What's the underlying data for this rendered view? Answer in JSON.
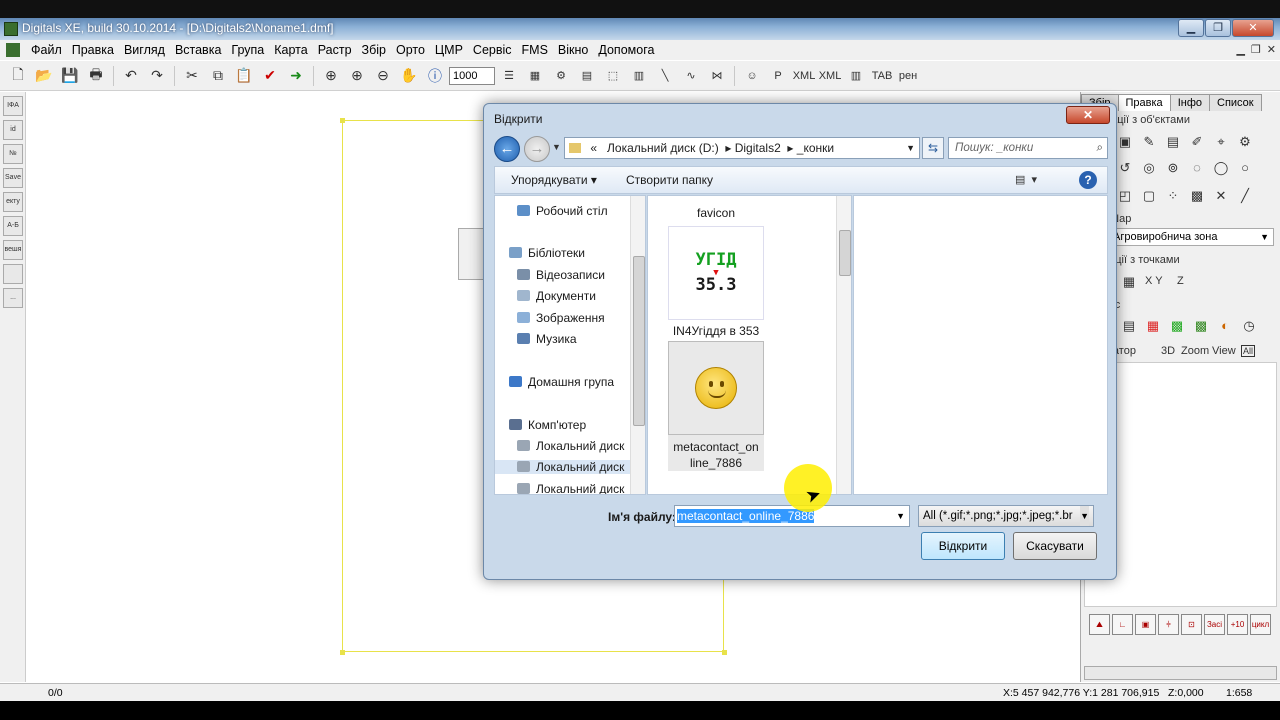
{
  "window": {
    "title": "Digitals XE, build 30.10.2014 - [D:\\Digitals2\\Noname1.dmf]"
  },
  "menu": [
    "Файл",
    "Правка",
    "Вигляд",
    "Вставка",
    "Група",
    "Карта",
    "Растр",
    "Збір",
    "Орто",
    "ЦМР",
    "Сервіс",
    "FMS",
    "Вікно",
    "Допомога"
  ],
  "toolbar": {
    "zoom_value": "1000",
    "icons": [
      "new-icon",
      "open-icon",
      "save-icon",
      "print-icon",
      "undo-icon",
      "redo-icon",
      "cut-icon",
      "copy-icon",
      "paste-icon",
      "check-icon",
      "arrow-icon",
      "zoom-extent-icon",
      "zoom-in-icon",
      "zoom-out-icon",
      "pan-icon",
      "info-icon"
    ]
  },
  "left_toolbar": [
    "ІФА 331",
    "id",
    "№",
    "Save",
    "екту",
    "А-Б",
    "вешя з",
    "",
    "..."
  ],
  "right_panel": {
    "tabs": [
      "Збір",
      "Правка",
      "Інфо",
      "Список"
    ],
    "active_tab": "Правка",
    "section_objects": "рації з об'єктами",
    "section_layer": "Шар",
    "layer_value": "Агровиробнича зона",
    "section_points": "рації з точками",
    "points_labels": [
      "X Y",
      "Z"
    ],
    "section_vis": "Віс",
    "navigator_label": "игатор",
    "navigator_items": [
      "3D",
      "Zoom",
      "View",
      "All"
    ],
    "bottom_buttons": [
      "Засі",
      "+10",
      "цикл"
    ]
  },
  "status": {
    "left": "0/0",
    "coords": "X:5 457 942,776 Y:1 281 706,915",
    "z": "Z:0,000",
    "scale": "1:658"
  },
  "dialog": {
    "title": "Відкрити",
    "breadcrumb": [
      "«",
      "Локальний диск (D:)",
      "Digitals2",
      "_конки"
    ],
    "search_placeholder": "Пошук: _конки",
    "organize": "Упорядкувати",
    "new_folder": "Створити папку",
    "tree": [
      {
        "label": "Робочий стіл",
        "indent": 1
      },
      {
        "label": "Бібліотеки",
        "indent": 0
      },
      {
        "label": "Відеозаписи",
        "indent": 1
      },
      {
        "label": "Документи",
        "indent": 1
      },
      {
        "label": "Зображення",
        "indent": 1
      },
      {
        "label": "Музика",
        "indent": 1
      },
      {
        "label": "Домашня група",
        "indent": 0
      },
      {
        "label": "Комп'ютер",
        "indent": 0
      },
      {
        "label": "Локальний диск",
        "indent": 1
      },
      {
        "label": "Локальний диск",
        "indent": 1,
        "selected": true
      },
      {
        "label": "Локальний диск",
        "indent": 1
      }
    ],
    "files": [
      {
        "name": "favicon"
      },
      {
        "name": "IN4Угіддя в 353",
        "thumb_text_top": "УГІД",
        "thumb_text_bottom": "35.3"
      },
      {
        "name": "metacontact_online_7886",
        "selected": true
      }
    ],
    "filename_label": "Ім'я файлу:",
    "filename_value": "metacontact_online_7886",
    "filetype": "All (*.gif;*.png;*.jpg;*.jpeg;*.br",
    "open_button": "Відкрити",
    "cancel_button": "Скасувати"
  }
}
